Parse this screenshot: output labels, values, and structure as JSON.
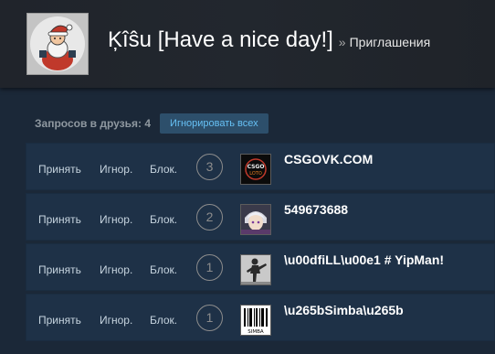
{
  "header": {
    "persona_name": "Ķîŝu [Have a nice day!]",
    "separator": "»",
    "page_name": "Приглашения"
  },
  "requests": {
    "count_label": "Запросов в друзья: 4",
    "ignore_all_label": "Игнорировать всех"
  },
  "row_actions": {
    "accept": "Принять",
    "ignore": "Игнор.",
    "block": "Блок."
  },
  "invites": [
    {
      "level": "3",
      "name": "CSGOVK.COM",
      "avatar_icon": "csgo-logo-avatar-icon",
      "avatar_text": "CSGO LOTO"
    },
    {
      "level": "2",
      "name": "549673688",
      "avatar_icon": "anime-character-avatar-icon"
    },
    {
      "level": "1",
      "name": "\\u00dfiLL\\u00e1 # YipMan!",
      "avatar_icon": "fighter-avatar-icon"
    },
    {
      "level": "1",
      "name": "\\u265bSimba\\u265b",
      "avatar_icon": "barcode-avatar-icon",
      "avatar_text": "SIMBA"
    }
  ],
  "colors": {
    "page_bg": "#1b2838",
    "row_bg": "#1e3147",
    "button_bg": "#2d4f6b",
    "button_text": "#66c0f4"
  }
}
